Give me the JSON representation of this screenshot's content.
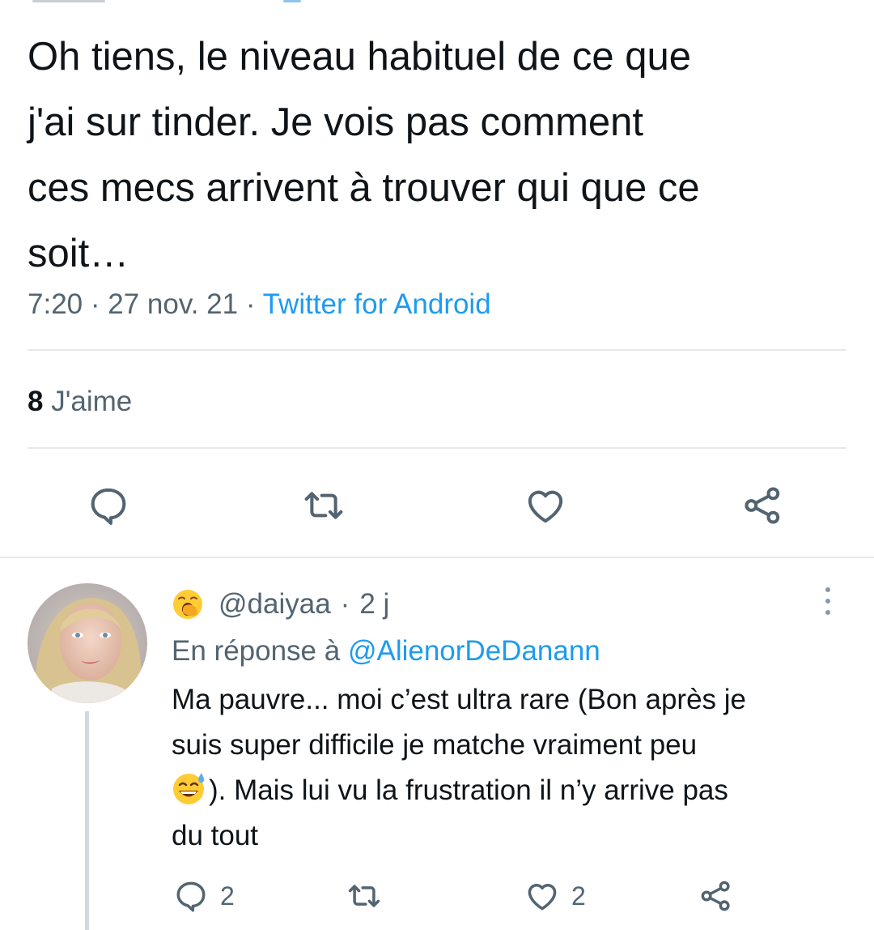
{
  "tweet": {
    "text": "Oh tiens, le niveau habituel de ce que\nj'ai sur tinder. Je vois pas comment\nces mecs arrivent à trouver qui que ce\nsoit…",
    "time": "7:20",
    "separator": "·",
    "date": "27 nov. 21",
    "source": "Twitter for Android",
    "likes_count": "8",
    "likes_label": "J'aime"
  },
  "actions": {
    "icons": [
      "reply-icon",
      "retweet-icon",
      "like-icon",
      "share-icon"
    ]
  },
  "reply": {
    "handle": "@daiyaa",
    "separator": "·",
    "age": "2 j",
    "in_reply_prefix": "En réponse à",
    "in_reply_mention": "@AlienorDeDanann",
    "text_line1": "Ma pauvre... moi c’est ultra rare (Bon après je",
    "text_line2": "suis super difficile je matche vraiment peu",
    "text_line3": "). Mais lui vu la frustration il n’y arrive pas",
    "text_line4": "du tout",
    "reply_count": "2",
    "like_count": "2"
  },
  "colors": {
    "text": "#0f1419",
    "secondary": "#536471",
    "link": "#1d9bf0",
    "divider": "#e6eaed",
    "thread_line": "#cfd9de"
  }
}
